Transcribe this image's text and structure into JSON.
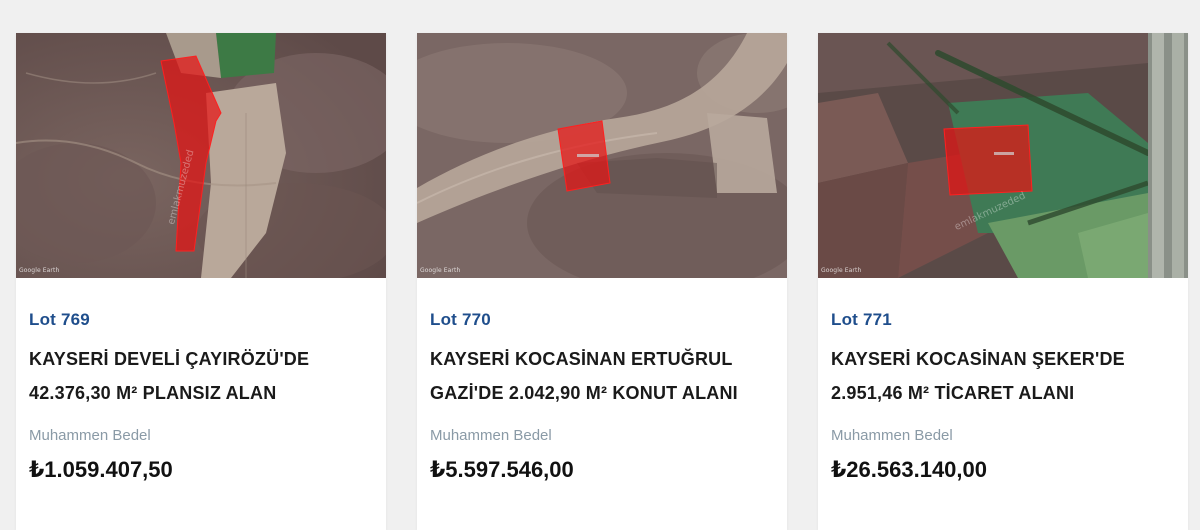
{
  "brand": {
    "accent": "#1f4e8c",
    "text": "#1a1a1a",
    "muted": "#8a9aa6",
    "parcel_red": "#e0201c"
  },
  "cards": [
    {
      "lot": "Lot 769",
      "title_line1": "KAYSERİ DEVELİ ÇAYIRÖZÜ'DE",
      "title_line2": "42.376,30 M² PLANSIZ ALAN",
      "price_label": "Muhammen Bedel",
      "price": "₺1.059.407,50",
      "map_credit": "Google Earth",
      "watermark": "emlakmuzeded"
    },
    {
      "lot": "Lot 770",
      "title_line1": "KAYSERİ KOCASİNAN ERTUĞRUL",
      "title_line2": "GAZİ'DE 2.042,90 M² KONUT ALANI",
      "price_label": "Muhammen Bedel",
      "price": "₺5.597.546,00",
      "map_credit": "Google Earth",
      "watermark": ""
    },
    {
      "lot": "Lot 771",
      "title_line1": "KAYSERİ KOCASİNAN ŞEKER'DE",
      "title_line2": "2.951,46 M² TİCARET ALANI",
      "price_label": "Muhammen Bedel",
      "price": "₺26.563.140,00",
      "map_credit": "Google Earth",
      "watermark": "emlakmuzeded"
    }
  ]
}
